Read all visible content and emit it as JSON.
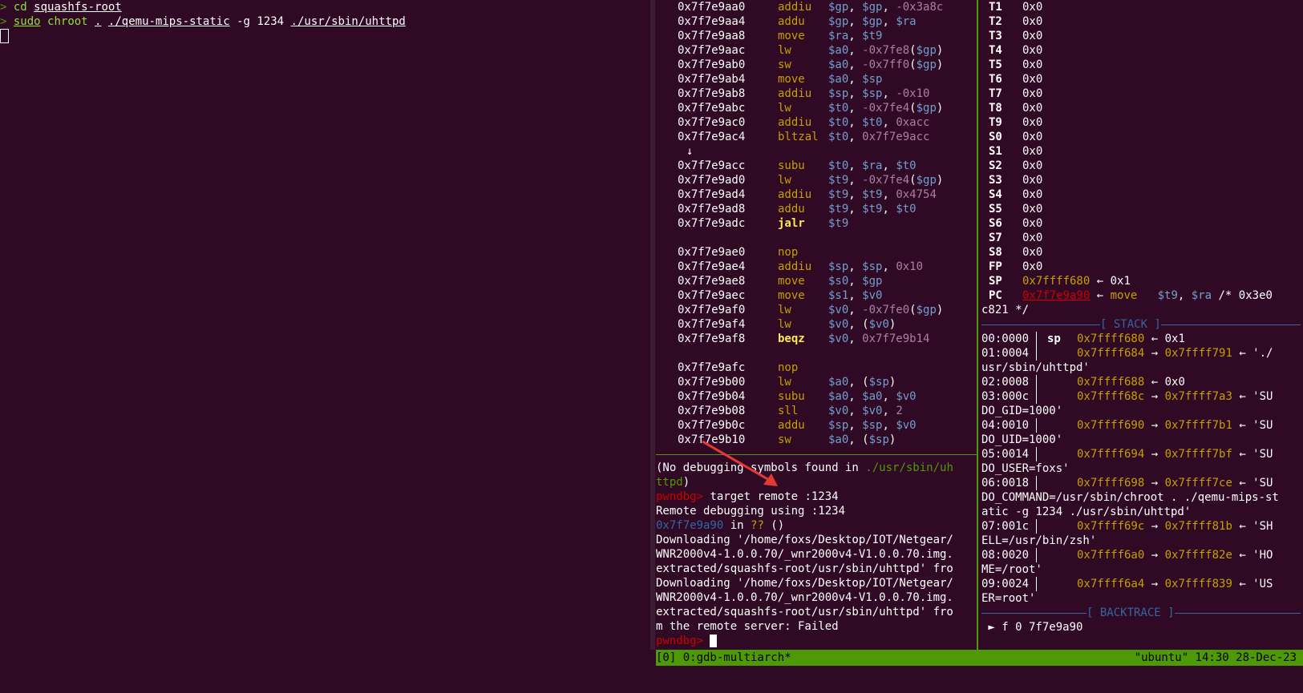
{
  "shell": {
    "prompt_symbol": ">",
    "line1_cmd": "cd",
    "line1_arg": "squashfs-root",
    "line2_sudo": "sudo",
    "line2_chroot": "chroot",
    "line2_dot": ".",
    "line2_qemu": "./qemu-mips-static",
    "line2_flags": "-g 1234",
    "line2_bin": "./usr/sbin/uhttpd"
  },
  "disasm": [
    {
      "addr": "0x7f7e9aa0",
      "mn": "addiu",
      "ops": [
        [
          "reg",
          "$gp"
        ],
        [
          "t",
          ", "
        ],
        [
          "reg",
          "$gp"
        ],
        [
          "t",
          ", "
        ],
        [
          "imm",
          "-0x3a8c"
        ]
      ]
    },
    {
      "addr": "0x7f7e9aa4",
      "mn": "addu",
      "ops": [
        [
          "reg",
          "$gp"
        ],
        [
          "t",
          ", "
        ],
        [
          "reg",
          "$gp"
        ],
        [
          "t",
          ", "
        ],
        [
          "reg",
          "$ra"
        ]
      ]
    },
    {
      "addr": "0x7f7e9aa8",
      "mn": "move",
      "ops": [
        [
          "reg",
          "$ra"
        ],
        [
          "t",
          ", "
        ],
        [
          "reg",
          "$t9"
        ]
      ]
    },
    {
      "addr": "0x7f7e9aac",
      "mn": "lw",
      "ops": [
        [
          "reg",
          "$a0"
        ],
        [
          "t",
          ", "
        ],
        [
          "imm",
          "-0x7fe8"
        ],
        [
          "t",
          "("
        ],
        [
          "reg",
          "$gp"
        ],
        [
          "t",
          ")"
        ]
      ]
    },
    {
      "addr": "0x7f7e9ab0",
      "mn": "sw",
      "ops": [
        [
          "reg",
          "$a0"
        ],
        [
          "t",
          ", "
        ],
        [
          "imm",
          "-0x7ff0"
        ],
        [
          "t",
          "("
        ],
        [
          "reg",
          "$gp"
        ],
        [
          "t",
          ")"
        ]
      ]
    },
    {
      "addr": "0x7f7e9ab4",
      "mn": "move",
      "ops": [
        [
          "reg",
          "$a0"
        ],
        [
          "t",
          ", "
        ],
        [
          "reg",
          "$sp"
        ]
      ]
    },
    {
      "addr": "0x7f7e9ab8",
      "mn": "addiu",
      "ops": [
        [
          "reg",
          "$sp"
        ],
        [
          "t",
          ", "
        ],
        [
          "reg",
          "$sp"
        ],
        [
          "t",
          ", "
        ],
        [
          "imm",
          "-0x10"
        ]
      ]
    },
    {
      "addr": "0x7f7e9abc",
      "mn": "lw",
      "ops": [
        [
          "reg",
          "$t0"
        ],
        [
          "t",
          ", "
        ],
        [
          "imm",
          "-0x7fe4"
        ],
        [
          "t",
          "("
        ],
        [
          "reg",
          "$gp"
        ],
        [
          "t",
          ")"
        ]
      ]
    },
    {
      "addr": "0x7f7e9ac0",
      "mn": "addiu",
      "ops": [
        [
          "reg",
          "$t0"
        ],
        [
          "t",
          ", "
        ],
        [
          "reg",
          "$t0"
        ],
        [
          "t",
          ", "
        ],
        [
          "imm",
          "0xacc"
        ]
      ]
    },
    {
      "addr": "0x7f7e9ac4",
      "mn": "bltzal",
      "ops": [
        [
          "reg",
          "$t0"
        ],
        [
          "t",
          ", "
        ],
        [
          "imm",
          "0x7f7e9acc"
        ]
      ]
    },
    {
      "arrow": "↓"
    },
    {
      "addr": "0x7f7e9acc",
      "mn": "subu",
      "ops": [
        [
          "reg",
          "$t0"
        ],
        [
          "t",
          ", "
        ],
        [
          "reg",
          "$ra"
        ],
        [
          "t",
          ", "
        ],
        [
          "reg",
          "$t0"
        ]
      ]
    },
    {
      "addr": "0x7f7e9ad0",
      "mn": "lw",
      "ops": [
        [
          "reg",
          "$t9"
        ],
        [
          "t",
          ", "
        ],
        [
          "imm",
          "-0x7fe4"
        ],
        [
          "t",
          "("
        ],
        [
          "reg",
          "$gp"
        ],
        [
          "t",
          ")"
        ]
      ]
    },
    {
      "addr": "0x7f7e9ad4",
      "mn": "addiu",
      "ops": [
        [
          "reg",
          "$t9"
        ],
        [
          "t",
          ", "
        ],
        [
          "reg",
          "$t9"
        ],
        [
          "t",
          ", "
        ],
        [
          "imm",
          "0x4754"
        ]
      ]
    },
    {
      "addr": "0x7f7e9ad8",
      "mn": "addu",
      "ops": [
        [
          "reg",
          "$t9"
        ],
        [
          "t",
          ", "
        ],
        [
          "reg",
          "$t9"
        ],
        [
          "t",
          ", "
        ],
        [
          "reg",
          "$t0"
        ]
      ]
    },
    {
      "addr": "0x7f7e9adc",
      "mn": "jalr",
      "bold": true,
      "ops": [
        [
          "reg",
          "$t9"
        ]
      ]
    },
    {
      "blank": true
    },
    {
      "addr": "0x7f7e9ae0",
      "mn": "nop",
      "ops": []
    },
    {
      "addr": "0x7f7e9ae4",
      "mn": "addiu",
      "ops": [
        [
          "reg",
          "$sp"
        ],
        [
          "t",
          ", "
        ],
        [
          "reg",
          "$sp"
        ],
        [
          "t",
          ", "
        ],
        [
          "imm",
          "0x10"
        ]
      ]
    },
    {
      "addr": "0x7f7e9ae8",
      "mn": "move",
      "ops": [
        [
          "reg",
          "$s0"
        ],
        [
          "t",
          ", "
        ],
        [
          "reg",
          "$gp"
        ]
      ]
    },
    {
      "addr": "0x7f7e9aec",
      "mn": "move",
      "ops": [
        [
          "reg",
          "$s1"
        ],
        [
          "t",
          ", "
        ],
        [
          "reg",
          "$v0"
        ]
      ]
    },
    {
      "addr": "0x7f7e9af0",
      "mn": "lw",
      "ops": [
        [
          "reg",
          "$v0"
        ],
        [
          "t",
          ", "
        ],
        [
          "imm",
          "-0x7fe0"
        ],
        [
          "t",
          "("
        ],
        [
          "reg",
          "$gp"
        ],
        [
          "t",
          ")"
        ]
      ]
    },
    {
      "addr": "0x7f7e9af4",
      "mn": "lw",
      "ops": [
        [
          "reg",
          "$v0"
        ],
        [
          "t",
          ", ("
        ],
        [
          "reg",
          "$v0"
        ],
        [
          "t",
          ")"
        ]
      ]
    },
    {
      "addr": "0x7f7e9af8",
      "mn": "beqz",
      "bold": true,
      "ops": [
        [
          "reg",
          "$v0"
        ],
        [
          "t",
          ", "
        ],
        [
          "imm",
          "0x7f7e9b14"
        ]
      ]
    },
    {
      "blank": true
    },
    {
      "addr": "0x7f7e9afc",
      "mn": "nop",
      "ops": []
    },
    {
      "addr": "0x7f7e9b00",
      "mn": "lw",
      "ops": [
        [
          "reg",
          "$a0"
        ],
        [
          "t",
          ", ("
        ],
        [
          "reg",
          "$sp"
        ],
        [
          "t",
          ")"
        ]
      ]
    },
    {
      "addr": "0x7f7e9b04",
      "mn": "subu",
      "ops": [
        [
          "reg",
          "$a0"
        ],
        [
          "t",
          ", "
        ],
        [
          "reg",
          "$a0"
        ],
        [
          "t",
          ", "
        ],
        [
          "reg",
          "$v0"
        ]
      ]
    },
    {
      "addr": "0x7f7e9b08",
      "mn": "sll",
      "ops": [
        [
          "reg",
          "$v0"
        ],
        [
          "t",
          ", "
        ],
        [
          "reg",
          "$v0"
        ],
        [
          "t",
          ", "
        ],
        [
          "imm",
          "2"
        ]
      ]
    },
    {
      "addr": "0x7f7e9b0c",
      "mn": "addu",
      "ops": [
        [
          "reg",
          "$sp"
        ],
        [
          "t",
          ", "
        ],
        [
          "reg",
          "$sp"
        ],
        [
          "t",
          ", "
        ],
        [
          "reg",
          "$v0"
        ]
      ]
    },
    {
      "addr": "0x7f7e9b10",
      "mn": "sw",
      "ops": [
        [
          "reg",
          "$a0"
        ],
        [
          "t",
          ", ("
        ],
        [
          "reg",
          "$sp"
        ],
        [
          "t",
          ")"
        ]
      ]
    }
  ],
  "cmd": {
    "l1a": "(No debugging symbols found in ",
    "l1path": "./usr/sbin/uh",
    "l2path": "ttpd",
    "l2b": ")",
    "prompt": "pwndbg>",
    "l3cmd": " target remote :1234",
    "l4": "Remote debugging using :1234",
    "l5addr": "0x7f7e9a90",
    "l5in": " in ",
    "l5q": "??",
    "l5paren": " ()",
    "l6": "Downloading '/home/foxs/Desktop/IOT/Netgear/",
    "l7": "WNR2000v4-1.0.0.70/_wnr2000v4-V1.0.0.70.img.",
    "l8": "extracted/squashfs-root/usr/sbin/uhttpd' fro",
    "l9": "Downloading '/home/foxs/Desktop/IOT/Netgear/",
    "l10": "WNR2000v4-1.0.0.70/_wnr2000v4-V1.0.0.70.img.",
    "l11": "extracted/squashfs-root/usr/sbin/uhttpd' fro",
    "l12": "m the remote server: Failed"
  },
  "registers": [
    {
      "name": "T1",
      "val": "0x0"
    },
    {
      "name": "T2",
      "val": "0x0"
    },
    {
      "name": "T3",
      "val": "0x0"
    },
    {
      "name": "T4",
      "val": "0x0"
    },
    {
      "name": "T5",
      "val": "0x0"
    },
    {
      "name": "T6",
      "val": "0x0"
    },
    {
      "name": "T7",
      "val": "0x0"
    },
    {
      "name": "T8",
      "val": "0x0"
    },
    {
      "name": "T9",
      "val": "0x0"
    },
    {
      "name": "S0",
      "val": "0x0"
    },
    {
      "name": "S1",
      "val": "0x0"
    },
    {
      "name": "S2",
      "val": "0x0"
    },
    {
      "name": "S3",
      "val": "0x0"
    },
    {
      "name": "S4",
      "val": "0x0"
    },
    {
      "name": "S5",
      "val": "0x0"
    },
    {
      "name": "S6",
      "val": "0x0"
    },
    {
      "name": "S7",
      "val": "0x0"
    },
    {
      "name": "S8",
      "val": "0x0"
    },
    {
      "name": "FP",
      "val": "0x0"
    }
  ],
  "sp_reg": {
    "name": "SP",
    "addr": "0x7ffff680",
    "arrow": " ← ",
    "val": "0x1"
  },
  "pc_reg": {
    "name": "PC",
    "addr": "0x7f7e9a90",
    "arrow": " ← ",
    "mn": "move",
    "pad": "   ",
    "op1": "$t9",
    "sep": ", ",
    "op2": "$ra",
    "cmt": " /* 0x3e0",
    "cont": "c821 */"
  },
  "stack_title": "[ STACK ]",
  "stack": [
    {
      "off": "00:0000",
      "label": "sp",
      "addr": "0x7ffff680",
      "rest": " ← 0x1"
    },
    {
      "off": "01:0004",
      "label": "",
      "addr": "0x7ffff684",
      "ptr": "0x7ffff791",
      "rest": " ← './",
      "cont": "usr/sbin/uhttpd'"
    },
    {
      "off": "02:0008",
      "label": "",
      "addr": "0x7ffff688",
      "rest": " ← 0x0"
    },
    {
      "off": "03:000c",
      "label": "",
      "addr": "0x7ffff68c",
      "ptr": "0x7ffff7a3",
      "rest": " ← 'SU",
      "cont": "DO_GID=1000'"
    },
    {
      "off": "04:0010",
      "label": "",
      "addr": "0x7ffff690",
      "ptr": "0x7ffff7b1",
      "rest": " ← 'SU",
      "cont": "DO_UID=1000'"
    },
    {
      "off": "05:0014",
      "label": "",
      "addr": "0x7ffff694",
      "ptr": "0x7ffff7bf",
      "rest": " ← 'SU",
      "cont": "DO_USER=foxs'"
    },
    {
      "off": "06:0018",
      "label": "",
      "addr": "0x7ffff698",
      "ptr": "0x7ffff7ce",
      "rest": " ← 'SU",
      "cont": "DO_COMMAND=/usr/sbin/chroot . ./qemu-mips-st",
      "cont2": "atic -g 1234 ./usr/sbin/uhttpd'"
    },
    {
      "off": "07:001c",
      "label": "",
      "addr": "0x7ffff69c",
      "ptr": "0x7ffff81b",
      "rest": " ← 'SH",
      "cont": "ELL=/usr/bin/zsh'"
    },
    {
      "off": "08:0020",
      "label": "",
      "addr": "0x7ffff6a0",
      "ptr": "0x7ffff82e",
      "rest": " ← 'HO",
      "cont": "ME=/root'"
    },
    {
      "off": "09:0024",
      "label": "",
      "addr": "0x7ffff6a4",
      "ptr": "0x7ffff839",
      "rest": " ← 'US",
      "cont": "ER=root'"
    }
  ],
  "backtrace_title": "[ BACKTRACE ]",
  "backtrace_line": " ► f 0 7f7e9a90",
  "status": {
    "left": "[0] 0:gdb-multiarch*",
    "right": "\"ubuntu\" 14:30 28-Dec-23"
  },
  "colors": {
    "bg": "#300a24",
    "status_green": "#4e9a06",
    "annotation_red": "#e53935"
  }
}
